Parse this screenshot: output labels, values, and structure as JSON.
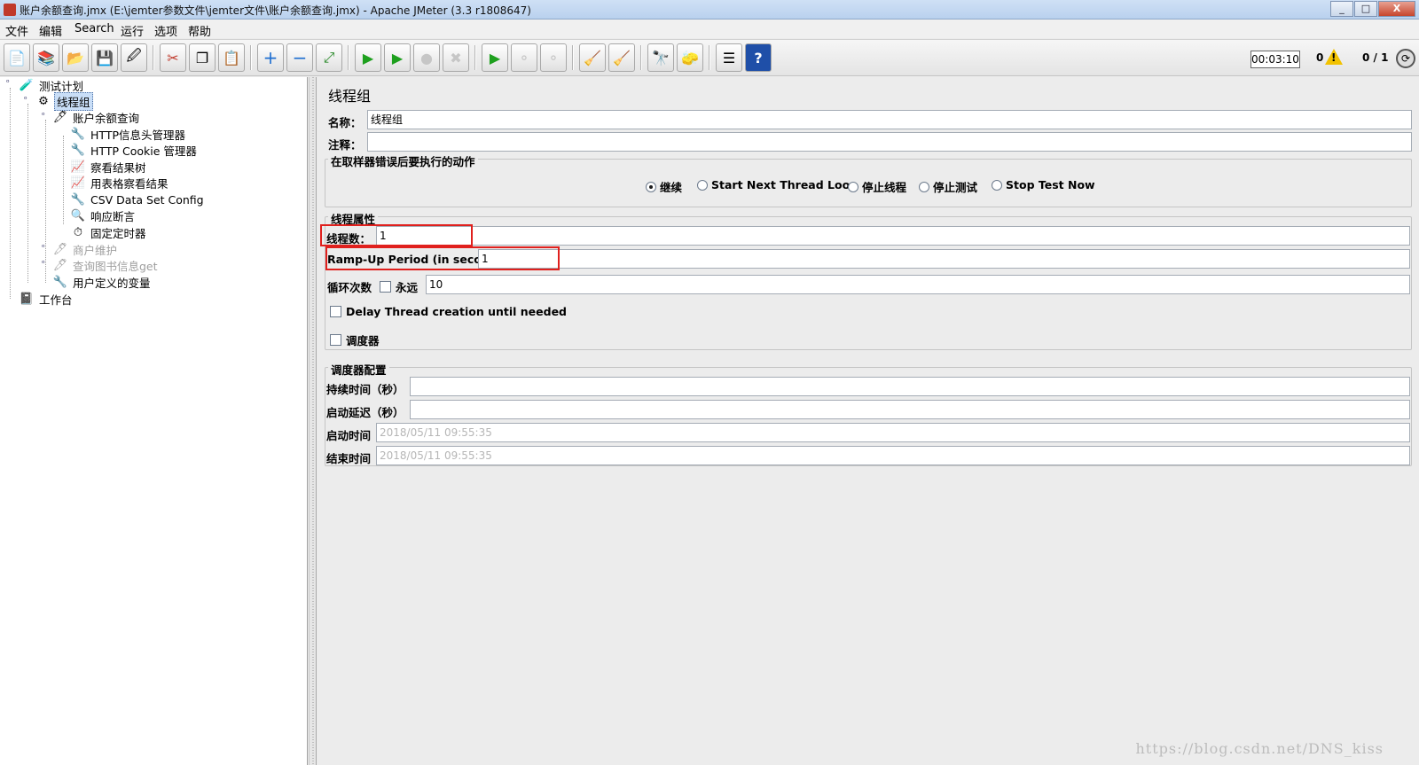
{
  "window": {
    "title": "账户余额查询.jmx (E:\\jemter参数文件\\jemter文件\\账户余额查询.jmx) - Apache JMeter (3.3 r1808647)",
    "controls": [
      "_",
      "□",
      "X"
    ]
  },
  "menu": [
    "文件",
    "编辑",
    "Search",
    "运行",
    "选项",
    "帮助"
  ],
  "toolbar": {
    "buttons": [
      {
        "name": "new",
        "glyph": "📄"
      },
      {
        "name": "templates",
        "glyph": "📚"
      },
      {
        "name": "open",
        "glyph": "📂"
      },
      {
        "name": "save",
        "glyph": "💾"
      },
      {
        "name": "save-as",
        "glyph": "🖉"
      },
      {
        "name": "cut",
        "glyph": "✂"
      },
      {
        "name": "copy",
        "glyph": "❐"
      },
      {
        "name": "paste",
        "glyph": "📋"
      },
      {
        "name": "expand-all",
        "glyph": "+"
      },
      {
        "name": "collapse-all",
        "glyph": "−"
      },
      {
        "name": "toggle",
        "glyph": "⤢"
      },
      {
        "name": "start",
        "glyph": "▶"
      },
      {
        "name": "start-no-pauses",
        "glyph": "▶"
      },
      {
        "name": "stop",
        "glyph": "●"
      },
      {
        "name": "shutdown",
        "glyph": "✖"
      },
      {
        "name": "remote-start",
        "glyph": "▶"
      },
      {
        "name": "remote-stop",
        "glyph": "⚬"
      },
      {
        "name": "remote-shutdown",
        "glyph": "⚬"
      },
      {
        "name": "clear",
        "glyph": "🧹"
      },
      {
        "name": "clear-all",
        "glyph": "🧹"
      },
      {
        "name": "search",
        "glyph": "🔭"
      },
      {
        "name": "reset-search",
        "glyph": "🧽"
      },
      {
        "name": "function-helper",
        "glyph": "☰"
      },
      {
        "name": "help",
        "glyph": "?"
      }
    ],
    "timer": "00:03:10",
    "error_count": "0",
    "thread_count": "0 / 1"
  },
  "tree": {
    "nodes": [
      {
        "label": "测试计划",
        "icon": "🧪",
        "disabled": false,
        "selected": false
      },
      {
        "label": "线程组",
        "icon": "⚙",
        "disabled": false,
        "selected": true
      },
      {
        "label": "账户余额查询",
        "icon": "🖊",
        "disabled": false,
        "selected": false
      },
      {
        "label": "HTTP信息头管理器",
        "icon": "🔧",
        "disabled": false,
        "selected": false
      },
      {
        "label": "HTTP Cookie 管理器",
        "icon": "🔧",
        "disabled": false,
        "selected": false
      },
      {
        "label": "察看结果树",
        "icon": "📈",
        "disabled": false,
        "selected": false
      },
      {
        "label": "用表格察看结果",
        "icon": "📈",
        "disabled": false,
        "selected": false
      },
      {
        "label": "CSV Data Set Config",
        "icon": "🔧",
        "disabled": false,
        "selected": false
      },
      {
        "label": "响应断言",
        "icon": "🔍",
        "disabled": false,
        "selected": false
      },
      {
        "label": "固定定时器",
        "icon": "⏱",
        "disabled": false,
        "selected": false
      },
      {
        "label": "商户维护",
        "icon": "🖊",
        "disabled": true,
        "selected": false
      },
      {
        "label": "查询图书信息get",
        "icon": "🖊",
        "disabled": true,
        "selected": false
      },
      {
        "label": "用户定义的变量",
        "icon": "🔧",
        "disabled": false,
        "selected": false
      },
      {
        "label": "工作台",
        "icon": "📓",
        "disabled": false,
        "selected": false
      }
    ]
  },
  "main": {
    "title": "线程组",
    "name_label": "名称：",
    "name_value": "线程组",
    "comment_label": "注释：",
    "comment_value": "",
    "on_error": {
      "title": "在取样器错误后要执行的动作",
      "options": [
        {
          "label": "继续",
          "checked": true
        },
        {
          "label": "Start Next Thread Loop",
          "checked": false
        },
        {
          "label": "停止线程",
          "checked": false
        },
        {
          "label": "停止测试",
          "checked": false
        },
        {
          "label": "Stop Test Now",
          "checked": false
        }
      ]
    },
    "thread_props": {
      "title": "线程属性",
      "threads_label": "线程数：",
      "threads_value": "1",
      "rampup_label": "Ramp-Up Period (in seconds):",
      "rampup_value": "1",
      "loop_label": "循环次数",
      "forever_label": "永远",
      "loop_value": "10",
      "delay_label": "Delay Thread creation until needed",
      "scheduler_label": "调度器"
    },
    "scheduler": {
      "title": "调度器配置",
      "duration_label": "持续时间（秒）",
      "duration_value": "",
      "delay_label": "启动延迟（秒）",
      "delay_value": "",
      "start_label": "启动时间",
      "start_value": "2018/05/11 09:55:35",
      "end_label": "结束时间",
      "end_value": "2018/05/11 09:55:35"
    }
  },
  "watermark": "https://blog.csdn.net/DNS_kiss",
  "colors": {
    "highlight": "#e0201d",
    "selection": "#c9def7"
  }
}
